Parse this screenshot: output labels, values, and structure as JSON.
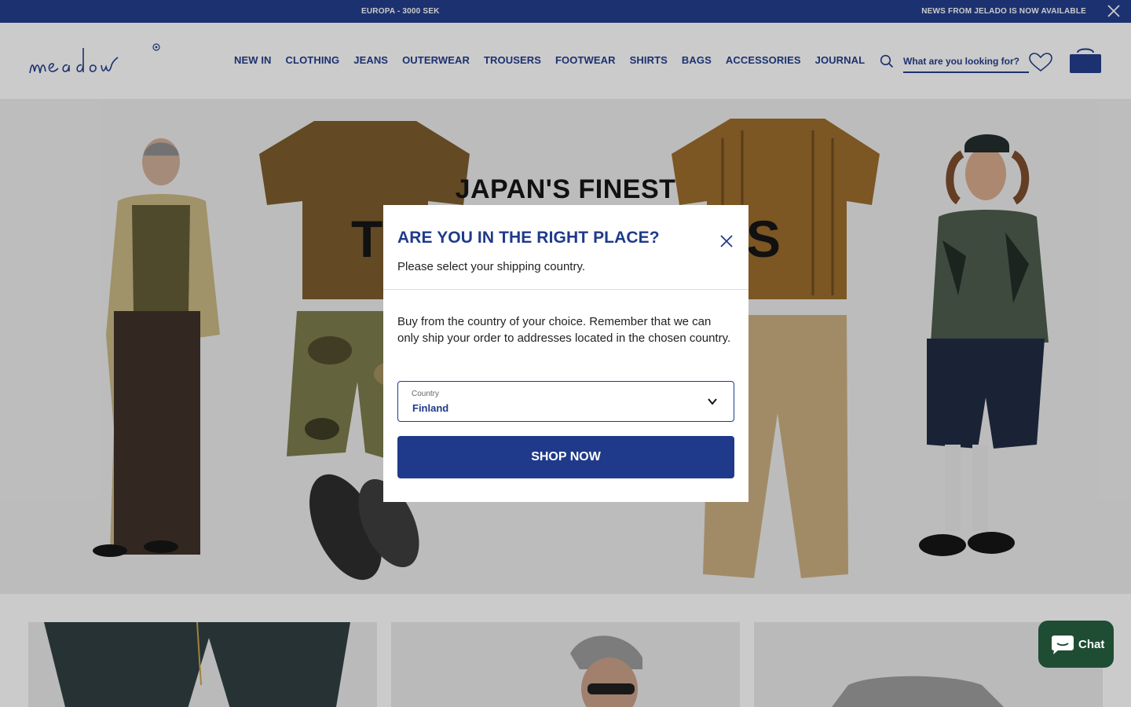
{
  "announcement": {
    "left_text": "EUROPA - 3000 SEK",
    "right_text": "NEWS FROM JELADO IS NOW AVAILABLE"
  },
  "header": {
    "logo_text": "meadow",
    "nav": [
      "NEW IN",
      "CLOTHING",
      "JEANS",
      "OUTERWEAR",
      "TROUSERS",
      "FOOTWEAR",
      "SHIRTS",
      "BAGS",
      "ACCESSORIES",
      "JOURNAL"
    ],
    "search_placeholder": "What are you looking for?"
  },
  "hero": {
    "title_top": "JAPAN'S FINEST",
    "title_big_left": "T",
    "title_big_right": "S"
  },
  "modal": {
    "title": "ARE YOU IN THE RIGHT PLACE?",
    "subtitle": "Please select your shipping country.",
    "body": "Buy from the country of your choice. Remember that we can only ship your order to addresses located in the chosen country.",
    "country_label": "Country",
    "country_value": "Finland",
    "button_label": "SHOP NOW"
  },
  "chat": {
    "label": "Chat"
  },
  "colors": {
    "brand_blue": "#1f3a8a",
    "chat_green": "#1f4d34"
  }
}
